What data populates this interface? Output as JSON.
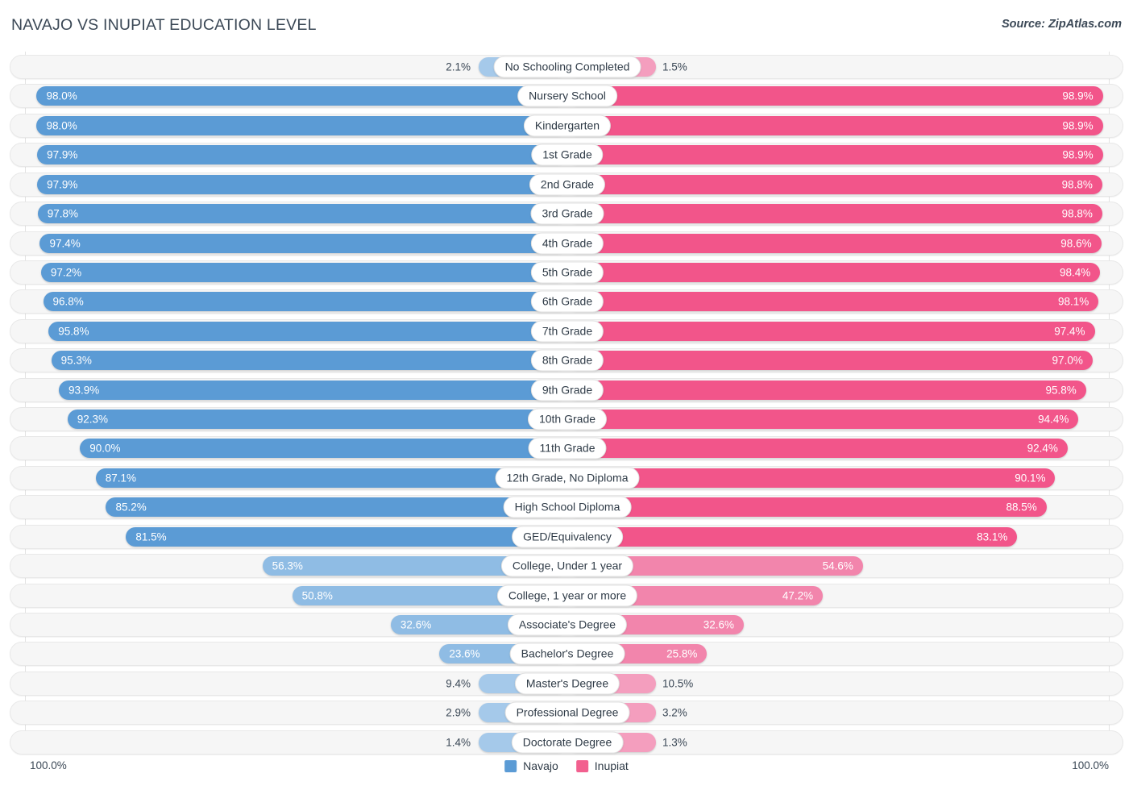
{
  "header": {
    "title": "NAVAJO VS INUPIAT EDUCATION LEVEL",
    "source": "Source: ZipAtlas.com"
  },
  "axis": {
    "left_end_label": "100.0%",
    "right_end_label": "100.0%"
  },
  "legend": {
    "items": [
      {
        "label": "Navajo",
        "color": "#5b9bd5"
      },
      {
        "label": "Inupiat",
        "color": "#f2608f"
      }
    ]
  },
  "colors": {
    "navajo_strong": "#5b9bd5",
    "navajo_light": "#8fbce4",
    "navajo_lighter": "#a5c9ea",
    "inupiat_strong": "#f2558a",
    "inupiat_light": "#f285ac",
    "inupiat_lighter": "#f49ebe",
    "row_track": "#f6f6f6",
    "text": "#3b4856"
  },
  "chart_data": {
    "type": "bar",
    "title": "NAVAJO VS INUPIAT EDUCATION LEVEL",
    "subtitle": "Source: ZipAtlas.com",
    "orientation": "horizontal-diverging",
    "xlabel": "",
    "ylabel": "",
    "xlim": [
      0,
      100
    ],
    "unit": "%",
    "grid": false,
    "legend_position": "bottom-center",
    "categories": [
      "No Schooling Completed",
      "Nursery School",
      "Kindergarten",
      "1st Grade",
      "2nd Grade",
      "3rd Grade",
      "4th Grade",
      "5th Grade",
      "6th Grade",
      "7th Grade",
      "8th Grade",
      "9th Grade",
      "10th Grade",
      "11th Grade",
      "12th Grade, No Diploma",
      "High School Diploma",
      "GED/Equivalency",
      "College, Under 1 year",
      "College, 1 year or more",
      "Associate's Degree",
      "Bachelor's Degree",
      "Master's Degree",
      "Professional Degree",
      "Doctorate Degree"
    ],
    "series": [
      {
        "name": "Navajo",
        "color": "#5b9bd5",
        "values": [
          2.1,
          98.0,
          98.0,
          97.9,
          97.9,
          97.8,
          97.4,
          97.2,
          96.8,
          95.8,
          95.3,
          93.9,
          92.3,
          90.0,
          87.1,
          85.2,
          81.5,
          56.3,
          50.8,
          32.6,
          23.6,
          9.4,
          2.9,
          1.4
        ],
        "labels": [
          "2.1%",
          "98.0%",
          "98.0%",
          "97.9%",
          "97.9%",
          "97.8%",
          "97.4%",
          "97.2%",
          "96.8%",
          "95.8%",
          "95.3%",
          "93.9%",
          "92.3%",
          "90.0%",
          "87.1%",
          "85.2%",
          "81.5%",
          "56.3%",
          "50.8%",
          "32.6%",
          "23.6%",
          "9.4%",
          "2.9%",
          "1.4%"
        ]
      },
      {
        "name": "Inupiat",
        "color": "#f2558a",
        "values": [
          1.5,
          98.9,
          98.9,
          98.9,
          98.8,
          98.8,
          98.6,
          98.4,
          98.1,
          97.4,
          97.0,
          95.8,
          94.4,
          92.4,
          90.1,
          88.5,
          83.1,
          54.6,
          47.2,
          32.6,
          25.8,
          10.5,
          3.2,
          1.3
        ],
        "labels": [
          "1.5%",
          "98.9%",
          "98.9%",
          "98.9%",
          "98.8%",
          "98.8%",
          "98.6%",
          "98.4%",
          "98.1%",
          "97.4%",
          "97.0%",
          "95.8%",
          "94.4%",
          "92.4%",
          "90.1%",
          "88.5%",
          "83.1%",
          "54.6%",
          "47.2%",
          "32.6%",
          "25.8%",
          "10.5%",
          "3.2%",
          "1.3%"
        ]
      }
    ]
  }
}
